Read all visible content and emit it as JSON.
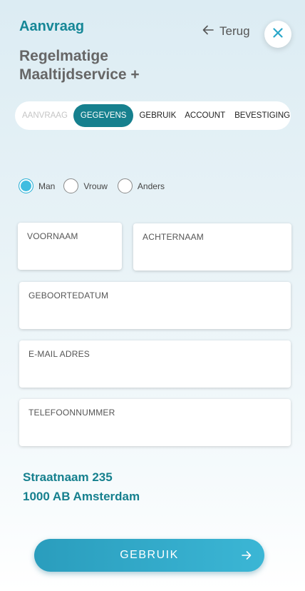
{
  "header": {
    "eyebrow": "Aanvraag",
    "back_label": "Terug",
    "title": "Regelmatige Maaltijdservice +"
  },
  "steps": [
    {
      "label": "AANVRAAG",
      "state": "done"
    },
    {
      "label": "GEGEVENS",
      "state": "active"
    },
    {
      "label": "GEBRUIK",
      "state": "upcoming"
    },
    {
      "label": "ACCOUNT",
      "state": "upcoming"
    },
    {
      "label": "BEVESTIGING",
      "state": "upcoming"
    }
  ],
  "gender": {
    "options": [
      {
        "label": "Man",
        "checked": true
      },
      {
        "label": "Vrouw",
        "checked": false
      },
      {
        "label": "Anders",
        "checked": false
      }
    ]
  },
  "fields": {
    "first_name": {
      "label": "VOORNAAM",
      "value": ""
    },
    "last_name": {
      "label": "ACHTERNAAM",
      "value": ""
    },
    "birthdate": {
      "label": "GEBOORTEDATUM",
      "value": ""
    },
    "email": {
      "label": "E-MAIL ADRES",
      "value": ""
    },
    "phone": {
      "label": "TELEFOONNUMMER",
      "value": ""
    }
  },
  "address": {
    "line1": "Straatnaam 235",
    "line2": "1000 AB Amsterdam"
  },
  "cta": {
    "label": "GEBRUIK",
    "icon": "arrow-right-icon"
  },
  "colors": {
    "primary": "#16808e",
    "accent": "#3bb6d5",
    "close": "#2aa7c9"
  }
}
